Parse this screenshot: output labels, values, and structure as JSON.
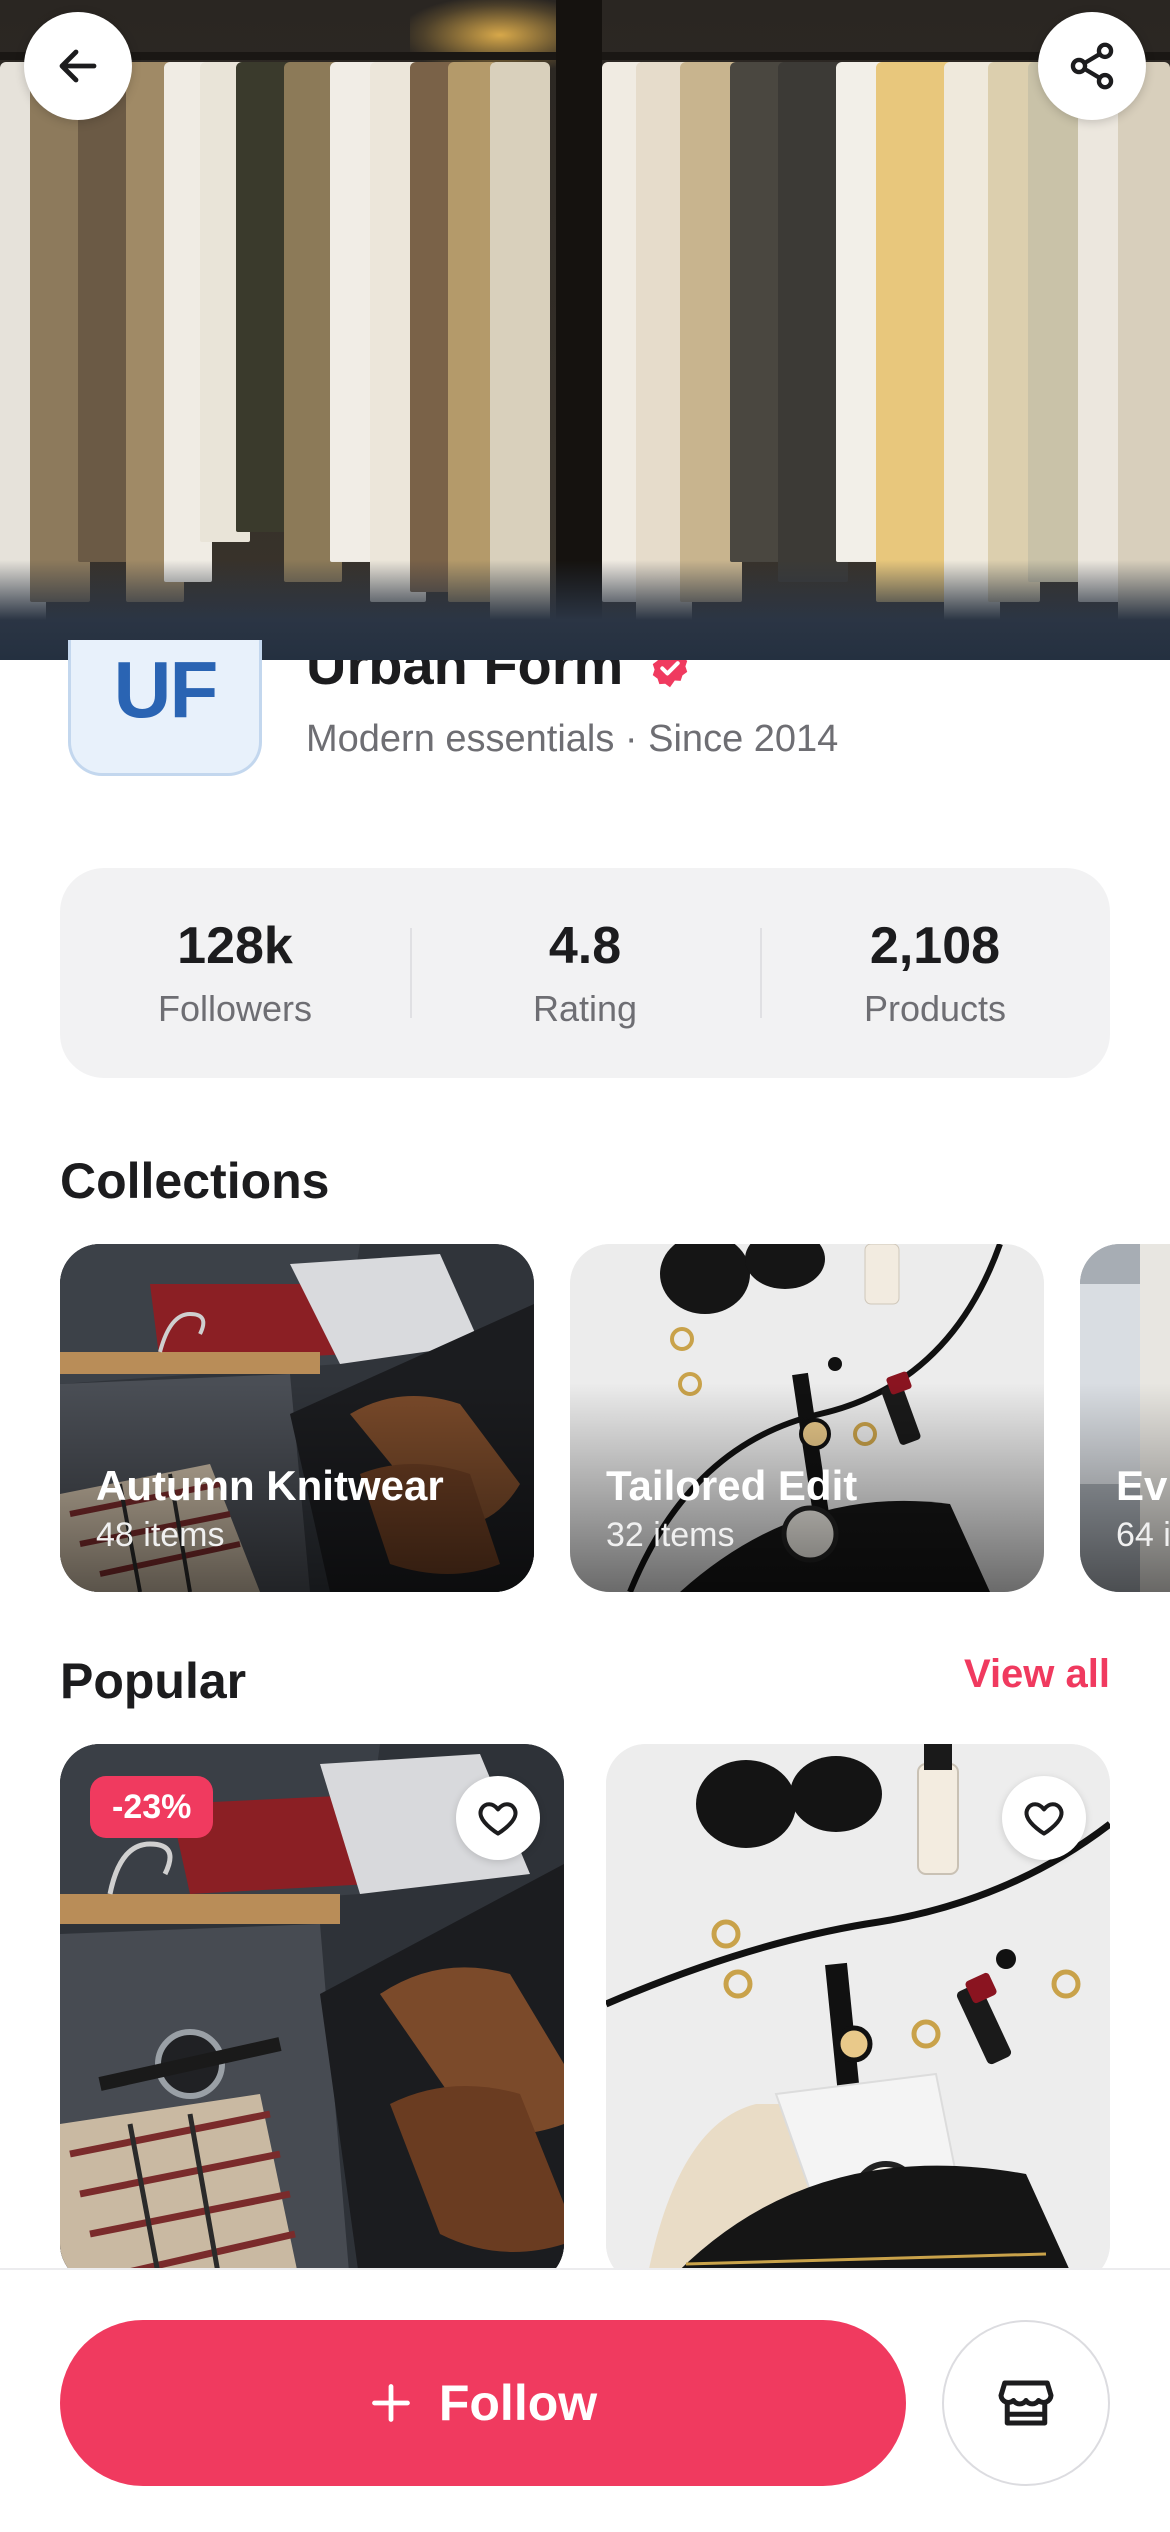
{
  "header": {
    "back_icon": "arrow-left-icon",
    "share_icon": "share-icon"
  },
  "brand": {
    "logo_text": "UF",
    "name": "Urban Form",
    "verified_icon": "verified-badge-icon",
    "tagline": "Modern essentials · Since 2014"
  },
  "stats": [
    {
      "value": "128k",
      "label": "Followers"
    },
    {
      "value": "4.8",
      "label": "Rating"
    },
    {
      "value": "2,108",
      "label": "Products"
    }
  ],
  "collections": {
    "title": "Collections",
    "items": [
      {
        "title": "Autumn Knitwear",
        "count": "48 items"
      },
      {
        "title": "Tailored Edit",
        "count": "32 items"
      },
      {
        "title": "Ev",
        "count": "64 i"
      }
    ]
  },
  "popular": {
    "title": "Popular",
    "view_all": "View all",
    "products": [
      {
        "discount": "-23%",
        "favorite_icon": "heart-outline-icon"
      },
      {
        "discount": "",
        "favorite_icon": "heart-outline-icon"
      }
    ]
  },
  "bottom_bar": {
    "follow_label": "Follow",
    "follow_icon": "plus-icon",
    "store_icon": "storefront-icon"
  },
  "colors": {
    "accent": "#f03a5f",
    "logo_bg": "#e8f1fb",
    "logo_text": "#2a64b3",
    "stats_bg": "#f2f2f3"
  }
}
